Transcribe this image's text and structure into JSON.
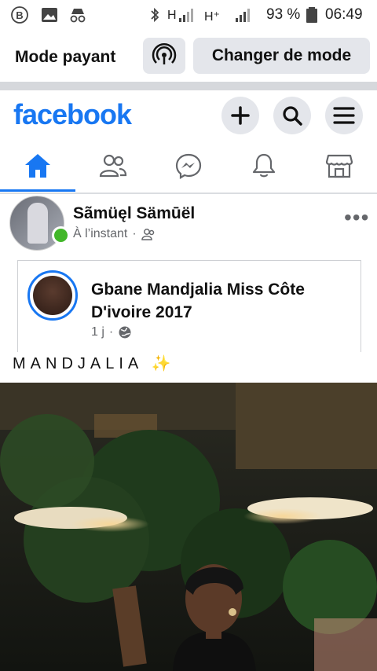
{
  "status_bar": {
    "network": "H",
    "network2": "H⁺",
    "battery": "93 %",
    "time": "06:49"
  },
  "mode_bar": {
    "label": "Mode payant",
    "change_button": "Changer de mode"
  },
  "header": {
    "logo": "facebook"
  },
  "post": {
    "author": "Sãmüęl Sämūël",
    "time": "À l’instant",
    "separator": "·",
    "shared": {
      "author": "Gbane Mandjalia Miss Côte D'ivoire 2017",
      "time": "1 j",
      "separator": "·"
    },
    "caption": "MANDJALIA ✨"
  },
  "colors": {
    "brand": "#1877f2",
    "online": "#42b72a",
    "secondary_text": "#65676b"
  }
}
